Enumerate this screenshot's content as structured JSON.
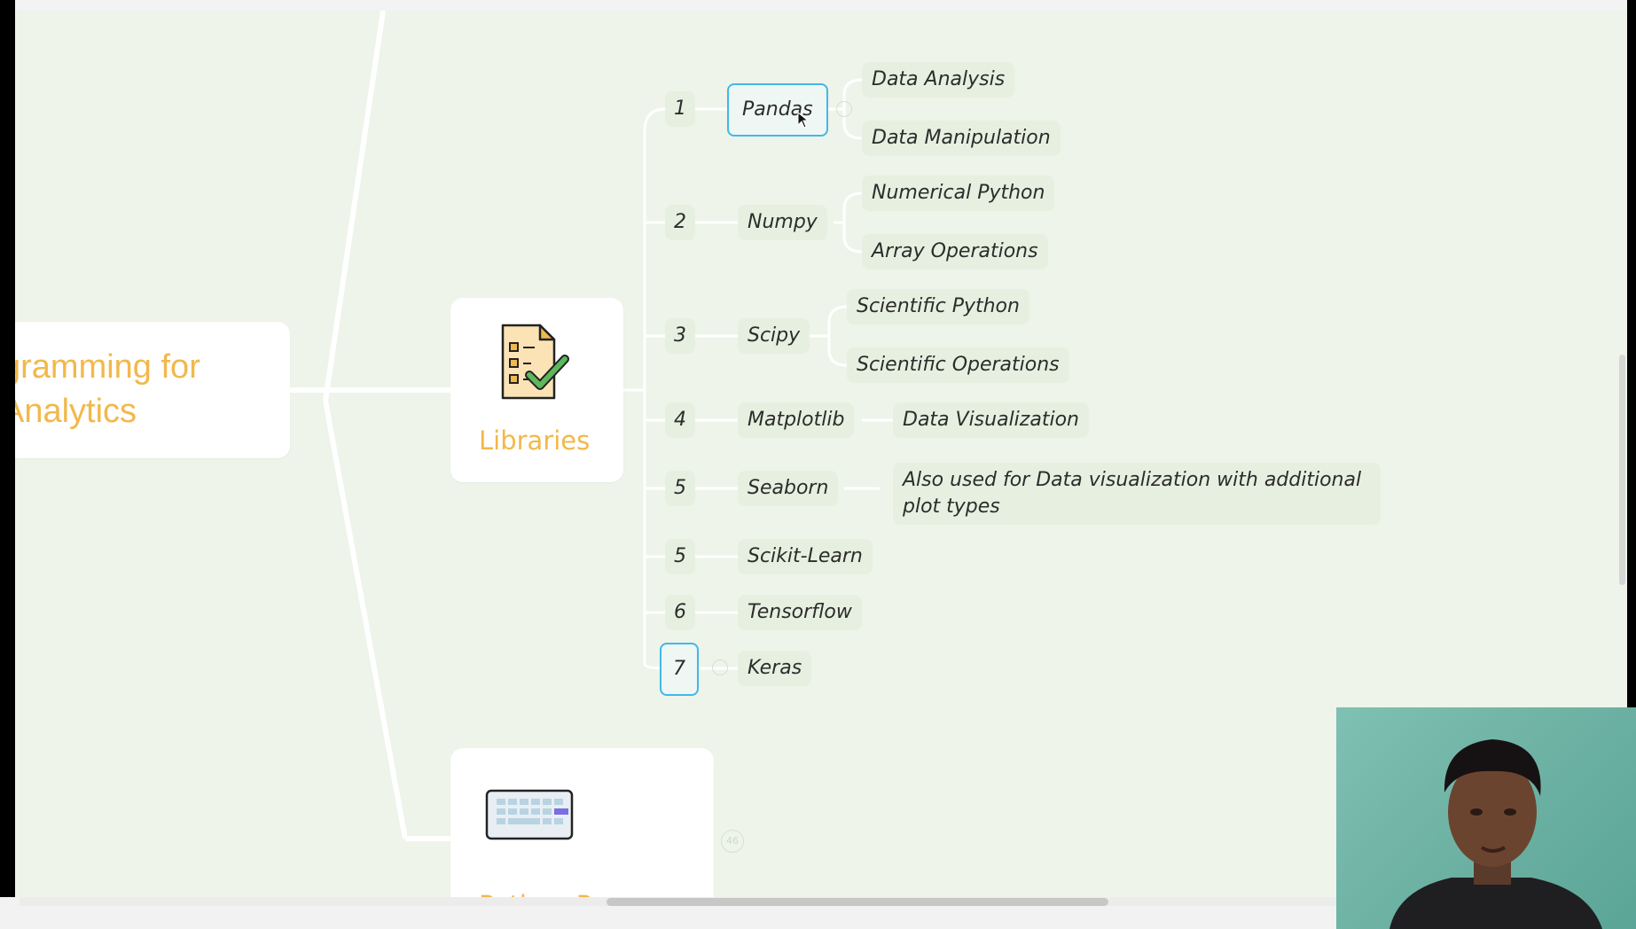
{
  "root": {
    "line1": "gramming for",
    "line2": "Analytics"
  },
  "libraries": {
    "label": "Libraries",
    "icon": "checklist-document-icon"
  },
  "python_program": {
    "label": "Python Program",
    "icon": "keyboard-icon",
    "badge": "46"
  },
  "items": [
    {
      "num": "1",
      "name": "Pandas",
      "children": [
        "Data Analysis",
        "Data Manipulation"
      ]
    },
    {
      "num": "2",
      "name": "Numpy",
      "children": [
        "Numerical Python",
        "Array Operations"
      ]
    },
    {
      "num": "3",
      "name": "Scipy",
      "children": [
        "Scientific Python",
        "Scientific Operations"
      ]
    },
    {
      "num": "4",
      "name": "Matplotlib",
      "children": [
        "Data Visualization"
      ]
    },
    {
      "num": "5",
      "name": "Seaborn",
      "children": [
        "Also used for Data visualization with additional plot types"
      ]
    },
    {
      "num": "5",
      "name": "Scikit-Learn",
      "children": []
    },
    {
      "num": "6",
      "name": "Tensorflow",
      "children": []
    },
    {
      "num": "7",
      "name": "Keras",
      "children": []
    }
  ],
  "colors": {
    "accent": "#f2b84b",
    "selection": "#41b8ea",
    "canvas": "#eef4e9"
  }
}
